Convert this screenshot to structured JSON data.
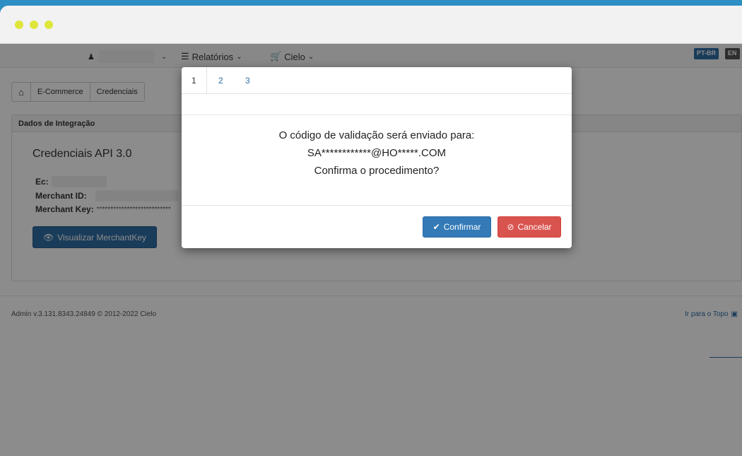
{
  "nav": {
    "reports_label": "Relatórios",
    "cielo_label": "Cielo",
    "lang_pt": "PT-BR",
    "lang_en": "EN"
  },
  "breadcrumb": {
    "items": [
      "E-Commerce",
      "Credenciais"
    ]
  },
  "section": {
    "header": "Dados de Integração",
    "title": "Credenciais API 3.0",
    "ec_label": "Ec:",
    "merchant_id_label": "Merchant ID:",
    "merchant_key_label": "Merchant Key:",
    "merchant_key_value": "***************************",
    "view_button_label": "Visualizar MerchantKey"
  },
  "footer": {
    "version": "Admin v.3.131.8343.24849 © 2012-2022 Cielo",
    "back_to_top": "Ir para o Topo"
  },
  "modal": {
    "pages": [
      "1",
      "2",
      "3"
    ],
    "line1": "O código de validação será enviado para:",
    "line2": "SA************@HO*****.COM",
    "line3": "Confirma o procedimento?",
    "confirm_label": "Confirmar",
    "cancel_label": "Cancelar"
  },
  "colors": {
    "primary": "#337ab7",
    "danger": "#d9534f",
    "traffic_light": "#dfe63a"
  }
}
